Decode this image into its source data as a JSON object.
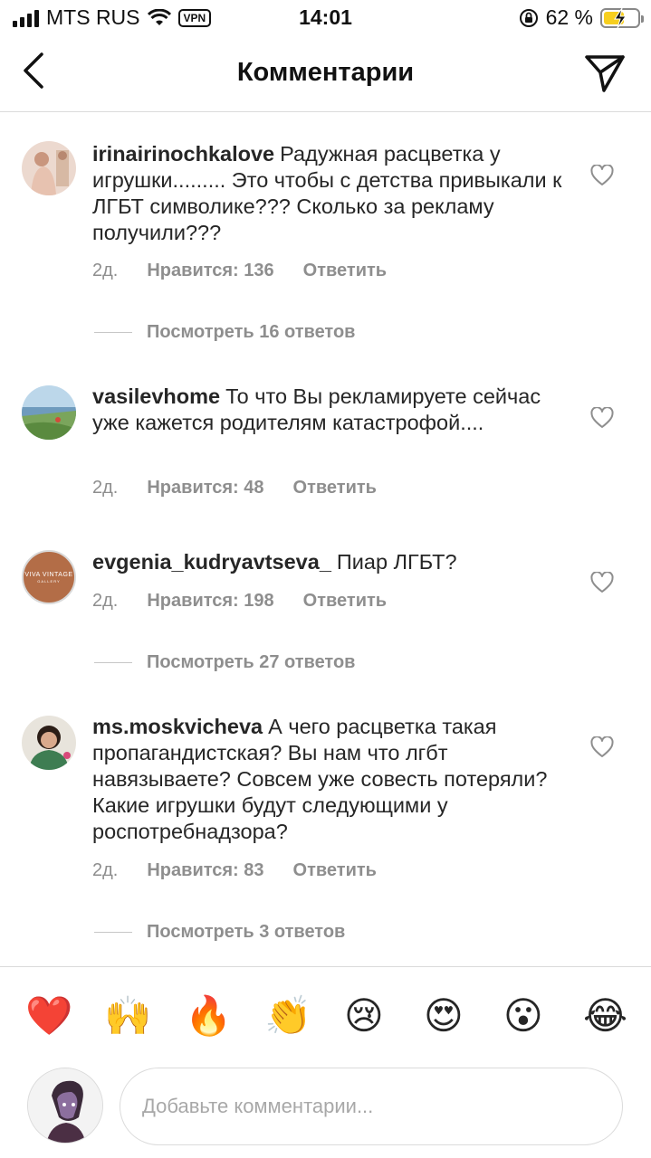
{
  "status_bar": {
    "carrier": "MTS RUS",
    "vpn": "VPN",
    "time": "14:01",
    "battery_percent": "62 %",
    "battery_level": 0.62
  },
  "header": {
    "title": "Комментарии",
    "back_icon": "chevron-left-icon",
    "send_icon": "paper-plane-icon"
  },
  "comments": [
    {
      "username": "irinairinochkalove",
      "text": "Радужная расцветка у игрушки......... Это чтобы с детства привыкали к ЛГБТ символике??? Сколько за рекламу получили???",
      "time": "2д.",
      "likes": "Нравится: 136",
      "reply": "Ответить",
      "view_replies": "Посмотреть 16 ответов"
    },
    {
      "username": "vasilevhome",
      "text": "То что Вы рекламируете сейчас уже кажется родителям катастрофой....",
      "time": "2д.",
      "likes": "Нравится: 48",
      "reply": "Ответить",
      "view_replies": ""
    },
    {
      "username": "evgenia_kudryavtseva_",
      "text": "Пиар ЛГБТ?",
      "time": "2д.",
      "likes": "Нравится: 198",
      "reply": "Ответить",
      "view_replies": "Посмотреть 27 ответов",
      "avatar_text": "VIVA VINTAGE",
      "avatar_subtext": "GALLERY"
    },
    {
      "username": "ms.moskvicheva",
      "text": "А чего расцветка такая пропагандистская? Вы нам что лгбт навязываете? Совсем уже совесть потеряли? Какие игрушки будут следующими у роспотребнадзора?",
      "time": "2д.",
      "likes": "Нравится: 83",
      "reply": "Ответить",
      "view_replies": "Посмотреть 3 ответов"
    }
  ],
  "emoji_bar": [
    "❤️",
    "🙌",
    "🔥",
    "👏",
    "😢",
    "😍",
    "😮",
    "😂"
  ],
  "composer": {
    "placeholder": "Добавьте комментарии..."
  },
  "colors": {
    "text": "#262626",
    "secondary": "#8e8e8e",
    "divider": "#dbdbdb",
    "battery": "#f7cf1f"
  }
}
